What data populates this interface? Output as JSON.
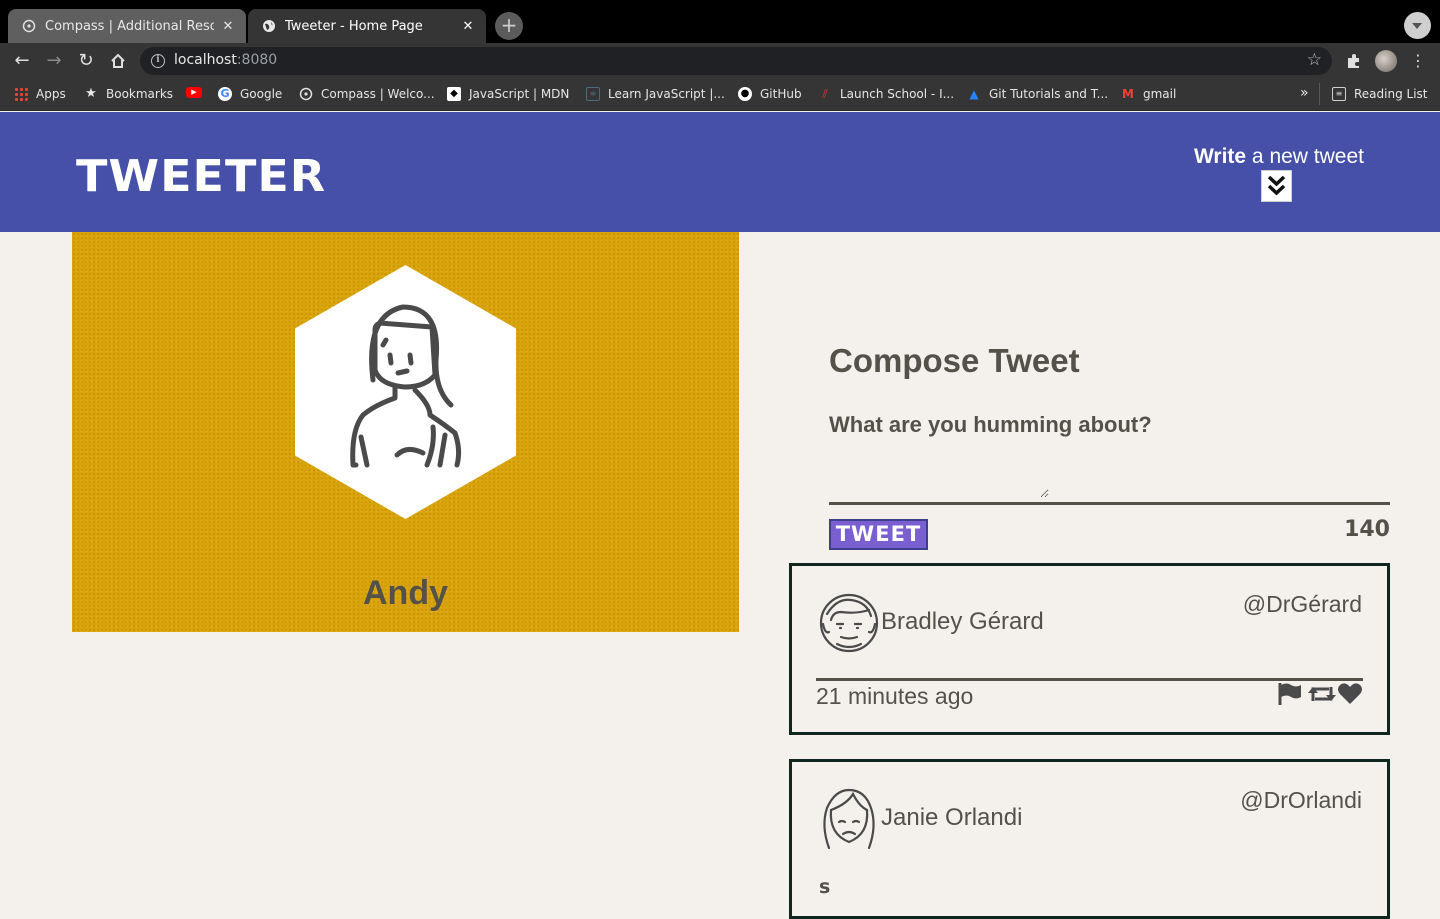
{
  "browser": {
    "tabs": [
      {
        "title": "Compass | Additional Resource",
        "active": false
      },
      {
        "title": "Tweeter - Home Page",
        "active": true
      }
    ],
    "url_host": "localhost",
    "url_port": ":8080",
    "bookmarks": [
      {
        "label": "Apps",
        "icon": "apps-grid-icon"
      },
      {
        "label": "Bookmarks",
        "icon": "star-icon"
      },
      {
        "label": "",
        "icon": "youtube-icon"
      },
      {
        "label": "Google",
        "icon": "google-icon"
      },
      {
        "label": "Compass | Welco...",
        "icon": "compass-icon"
      },
      {
        "label": "JavaScript | MDN",
        "icon": "mdn-icon"
      },
      {
        "label": "Learn JavaScript |...",
        "icon": "doc-icon"
      },
      {
        "label": "GitHub",
        "icon": "github-icon"
      },
      {
        "label": "Launch School - I...",
        "icon": "launch-school-icon"
      },
      {
        "label": "Git Tutorials and T...",
        "icon": "atlassian-icon"
      },
      {
        "label": "gmail",
        "icon": "gmail-icon"
      }
    ],
    "overflow_label": "»",
    "reading_list": "Reading List"
  },
  "site": {
    "brand": "TWEETER",
    "write_bold": "Write",
    "write_rest": " a new tweet"
  },
  "profile": {
    "name": "Andy"
  },
  "compose": {
    "title": "Compose Tweet",
    "label": "What are you humming about?",
    "button": "TWEET",
    "counter": "140"
  },
  "tweets": [
    {
      "name": "Bradley Gérard",
      "handle": "@DrGérard",
      "time": "21 minutes ago",
      "body": ""
    },
    {
      "name": "Janie Orlandi",
      "handle": "@DrOrlandi",
      "time": "",
      "body": "s"
    }
  ],
  "colors": {
    "nav_bg": "#4650a8",
    "profile_bg": "#d9a30a",
    "text": "#545149",
    "button_bg": "#7a5fd0",
    "page_bg": "#f4f1ec"
  }
}
